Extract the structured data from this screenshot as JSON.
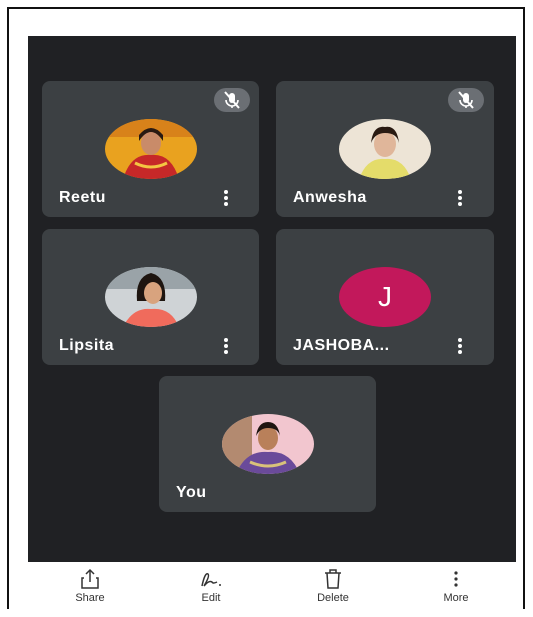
{
  "participants": [
    {
      "name": "Reetu",
      "muted": true
    },
    {
      "name": "Anwesha",
      "muted": true
    },
    {
      "name": "Lipsita",
      "muted": false
    },
    {
      "name": "JASHOBA...",
      "initial": "J",
      "avatar_color": "#c2185b",
      "muted": false
    },
    {
      "name": "You",
      "muted": false
    }
  ],
  "toolbar": {
    "share": "Share",
    "edit": "Edit",
    "delete": "Delete",
    "more": "More"
  }
}
